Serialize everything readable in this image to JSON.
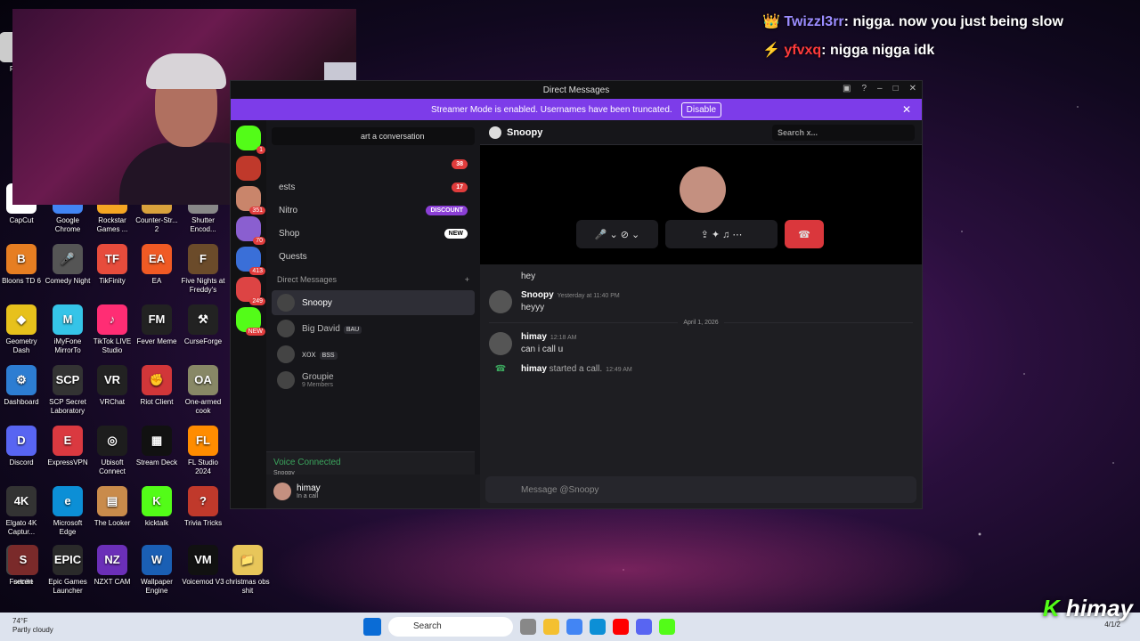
{
  "desktop_icons": [
    {
      "label": "Re",
      "glyph": "",
      "c": "#ccc"
    },
    {
      "label": "CapCut",
      "glyph": "✂",
      "c": "#fff"
    },
    {
      "label": "Google Chrome",
      "glyph": "G",
      "c": "#4285f4"
    },
    {
      "label": "Rockstar Games ...",
      "glyph": "R",
      "c": "#f5a623"
    },
    {
      "label": "Counter-Str... 2",
      "glyph": "CS",
      "c": "#d9a23c"
    },
    {
      "label": "Shutter Encod...",
      "glyph": "S",
      "c": "#888"
    },
    {
      "label": "Bloons TD 6",
      "glyph": "B",
      "c": "#e67e22"
    },
    {
      "label": "Comedy Night",
      "glyph": "🎤",
      "c": "#555"
    },
    {
      "label": "TikFinity",
      "glyph": "TF",
      "c": "#e74c3c"
    },
    {
      "label": "EA",
      "glyph": "EA",
      "c": "#f05a24"
    },
    {
      "label": "Five Nights at Freddy's",
      "glyph": "F",
      "c": "#6b4b2a"
    },
    {
      "label": "Geometry Dash",
      "glyph": "◆",
      "c": "#e7c11c"
    },
    {
      "label": "iMyFone MirrorTo",
      "glyph": "M",
      "c": "#35c4e8"
    },
    {
      "label": "TikTok LIVE Studio",
      "glyph": "♪",
      "c": "#ff2d74"
    },
    {
      "label": "Fever Meme",
      "glyph": "FM",
      "c": "#222"
    },
    {
      "label": "CurseForge",
      "glyph": "⚒",
      "c": "#222"
    },
    {
      "label": "Dashboard",
      "glyph": "⚙",
      "c": "#2d7dd2"
    },
    {
      "label": "SCP Secret Laboratory",
      "glyph": "SCP",
      "c": "#333"
    },
    {
      "label": "VRChat",
      "glyph": "VR",
      "c": "#222"
    },
    {
      "label": "Riot Client",
      "glyph": "✊",
      "c": "#d13639"
    },
    {
      "label": "One-armed cook",
      "glyph": "OA",
      "c": "#886"
    },
    {
      "label": "Discord",
      "glyph": "D",
      "c": "#5865f2"
    },
    {
      "label": "ExpressVPN",
      "glyph": "E",
      "c": "#da3940"
    },
    {
      "label": "Ubisoft Connect",
      "glyph": "◎",
      "c": "#1d1d1d"
    },
    {
      "label": "Stream Deck",
      "glyph": "▦",
      "c": "#111"
    },
    {
      "label": "FL Studio 2024",
      "glyph": "FL",
      "c": "#ff8c00"
    },
    {
      "label": "Elgato 4K Captur...",
      "glyph": "4K",
      "c": "#333"
    },
    {
      "label": "Microsoft Edge",
      "glyph": "e",
      "c": "#0c8fd6"
    },
    {
      "label": "The Looker",
      "glyph": "▤",
      "c": "#c98b4b"
    },
    {
      "label": "kicktalk",
      "glyph": "K",
      "c": "#53fc18"
    },
    {
      "label": "Trivia Tricks",
      "glyph": "?",
      "c": "#c0392b"
    },
    {
      "label": "Fortnite",
      "glyph": "F",
      "c": "#444"
    },
    {
      "label": "Epic Games Launcher",
      "glyph": "EPIC",
      "c": "#2a2a2a"
    },
    {
      "label": "NZXT CAM",
      "glyph": "NZ",
      "c": "#6b2fb8"
    },
    {
      "label": "Wallpaper Engine",
      "glyph": "W",
      "c": "#1a5fb4"
    },
    {
      "label": "Voicemod V3",
      "glyph": "VM",
      "c": "#111"
    },
    {
      "label": "christmas obs shit",
      "glyph": "📁",
      "c": "#e8c65a"
    },
    {
      "label": "secert",
      "glyph": "S",
      "c": "#7a2a2a"
    }
  ],
  "overlay_chat": [
    {
      "user": "Twizzl3rr",
      "text": "nigga. now you just being slow"
    },
    {
      "user": "yfvxq",
      "text": "nigga nigga idk"
    }
  ],
  "window": {
    "title": "Direct Messages",
    "streamer_text": "Streamer Mode is enabled. Usernames have been truncated.",
    "disable": "Disable"
  },
  "servers": [
    {
      "badge": "1"
    },
    {
      "badge": ""
    },
    {
      "badge": "351"
    },
    {
      "badge": "70"
    },
    {
      "badge": "413"
    },
    {
      "badge": "249"
    },
    {
      "badge": "NEW"
    }
  ],
  "sidebar": {
    "search": "art a conversation",
    "nav": [
      {
        "label": "",
        "badge": "38"
      },
      {
        "label": "ests",
        "badge": "17"
      },
      {
        "label": "Nitro",
        "badge": "DISCOUNT"
      },
      {
        "label": "Shop",
        "badge": "NEW"
      },
      {
        "label": "Quests",
        "badge": ""
      }
    ],
    "dm_header": "Direct Messages",
    "dm_add": "+",
    "dms": [
      {
        "name": "Snoopy",
        "tag": "",
        "sub": ""
      },
      {
        "name": "Big David",
        "tag": "BAU",
        "sub": ""
      },
      {
        "name": "xox",
        "tag": "BSS",
        "sub": ""
      },
      {
        "name": "Groupie",
        "tag": "",
        "sub": "9 Members"
      }
    ],
    "voice": {
      "title": "Voice Connected",
      "channel": "Snoopy"
    },
    "user": {
      "name": "himay",
      "status": "In a call"
    }
  },
  "channel": {
    "name": "Snoopy",
    "search": "Search x..."
  },
  "messages": [
    {
      "type": "cont",
      "text": "hey"
    },
    {
      "type": "msg",
      "name": "Snoopy",
      "time": "Yesterday at 11:40 PM",
      "text": "heyyy"
    },
    {
      "type": "date",
      "text": "April 1, 2026"
    },
    {
      "type": "msg",
      "name": "himay",
      "time": "12:18 AM",
      "text": "can i call u"
    },
    {
      "type": "call",
      "name": "himay",
      "text": "started a call.",
      "time": "12:49 AM"
    }
  ],
  "input_placeholder": "Message @Snoopy",
  "taskbar": {
    "temp": "74°F",
    "weather": "Partly cloudy",
    "search": "Search",
    "date": "4/1/2"
  },
  "brand": "himay"
}
